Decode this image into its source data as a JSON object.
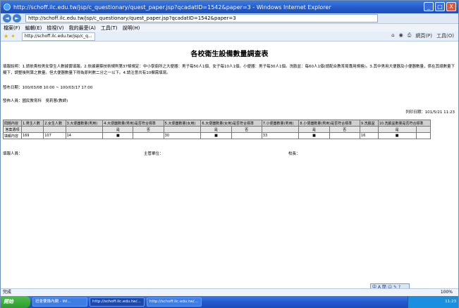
{
  "window": {
    "title": "http://schoff.ilc.edu.tw/jsp/c_questionary/quest_paper.jsp?qcadatID=1542&paper=3 - Windows Internet Explorer",
    "buttons": [
      "_",
      "□",
      "X"
    ]
  },
  "address_bar": {
    "url": "http://schoff.ilc.edu.tw/jsp/c_questionary/quest_paper.jsp?qcadatID=1542&paper=3"
  },
  "menu": [
    "檔案(F)",
    "編輯(E)",
    "檢視(V)",
    "我的最愛(A)",
    "工具(T)",
    "說明(H)"
  ],
  "tab": {
    "label": "http://schoff.ilc.edu.tw/jsp/c_q..."
  },
  "toolbar": {
    "page_label": "網頁(P)",
    "tools_label": "工具(O)"
  },
  "page": {
    "title": "各校衛生設備數量調查表",
    "description": "填報說明：1.請依貴校男女學生人數據實填報。2.依據建築技術規則第37條規定：中小學廁所之大便器：男子每50人1個、女子每10人1個。小便器：男子每30人1個。洗臉盆：每60人1個(請配合教育局專用規格)。3.其中男用大便器及小便器數量，係在其總數量下擬下，調整後則算之數量。但大便器數量下得為原判數二分之一以下。4.請注意共有10欄需填寫。",
    "period": "發布日期：100/03/08 10:00 ~ 100/03/17 17:00",
    "publisher": "發佈人員：國民教育科　吳莉蓉(教師)",
    "print_date": "列印日期：101/5/21 11:23",
    "table": {
      "header": [
        "問題內容",
        "1.男生人數",
        "2.女生人數",
        "3.大便器數量(男用)",
        "4.大便器數量(男用)是否符合標準",
        "5.大便器數量(女用)",
        "6.大便器數量(女用)是否符合標準",
        "7.小便器數量(男用)",
        "8.小便器數量(男用)是否符合標準",
        "9.洗臉盆",
        "10.洗臉盆數量是否符合標準"
      ],
      "sub": [
        "答案選項",
        "",
        "",
        "",
        "是",
        "否",
        "",
        "是",
        "否",
        "",
        "是",
        "否",
        "",
        "是"
      ],
      "row": [
        "填報內容",
        "169",
        "107",
        "14",
        "",
        "■",
        "",
        "30",
        "",
        "■",
        "",
        "33",
        "",
        "■",
        "",
        "16",
        "",
        "■"
      ]
    },
    "signatures": [
      "填報人員：",
      "主管單位：",
      "校長："
    ]
  },
  "status": {
    "text": "完成",
    "zoom": "100%"
  },
  "taskbar": {
    "start": "開始",
    "items": [
      "班會要錄內網 - Wi...",
      "http://schoff.ilc.edu.tw/...",
      "http://schoff.ilc.edu.tw/..."
    ],
    "clock": "11:23"
  }
}
